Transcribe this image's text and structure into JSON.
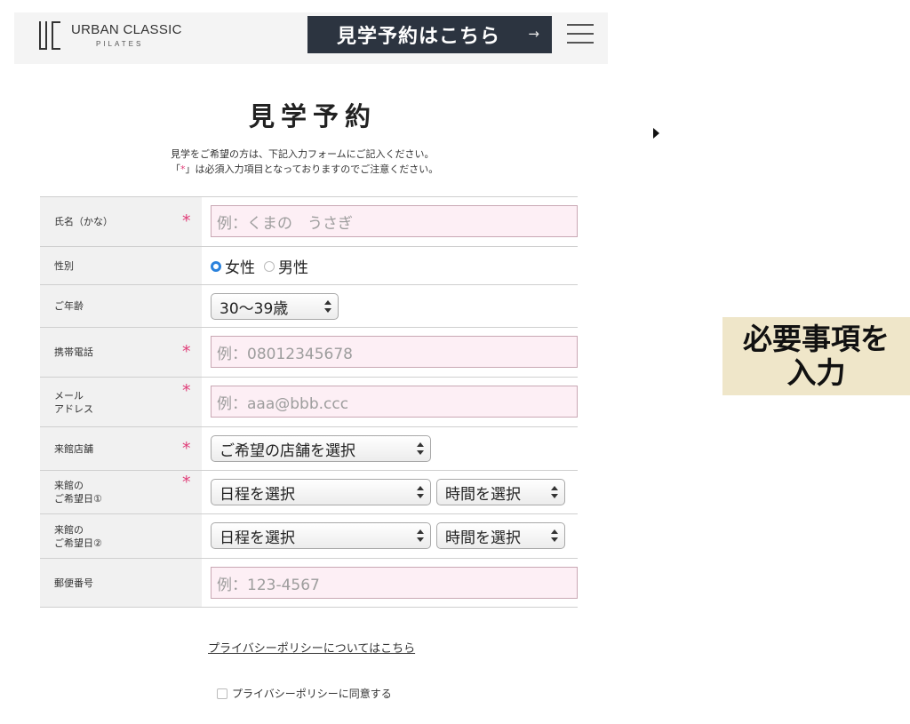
{
  "header": {
    "logo_name": "URBAN CLASSIC",
    "logo_sub": "PILATES",
    "cta_label": "見学予約はこちら",
    "cta_arrow": "→",
    "cta_color": "#2c3440"
  },
  "page": {
    "title": "見学予約",
    "intro_line1": "見学をご希望の方は、下記入力フォームにご記入ください。",
    "intro_line2_open": "「",
    "intro_line2_star": "*",
    "intro_line2_rest": "」は必須入力項目となっておりますのでご注意ください。",
    "required_color": "#e0407a"
  },
  "form": {
    "required_mark": "*",
    "name": {
      "label": "氏名（かな）",
      "placeholder": "例：くまの　うさぎ"
    },
    "gender": {
      "label": "性別",
      "options": [
        "女性",
        "男性"
      ],
      "selected": "女性"
    },
    "age": {
      "label": "ご年齢",
      "value": "30〜39歳"
    },
    "phone": {
      "label": "携帯電話",
      "placeholder": "例：08012345678"
    },
    "email": {
      "label_line1": "メール",
      "label_line2": "アドレス",
      "placeholder": "例：aaa@bbb.ccc"
    },
    "store": {
      "label": "来館店舗",
      "value": "ご希望の店舗を選択"
    },
    "visit1": {
      "label_line1": "来館の",
      "label_line2": "ご希望日①",
      "date": "日程を選択",
      "time": "時間を選択"
    },
    "visit2": {
      "label_line1": "来館の",
      "label_line2": "ご希望日②",
      "date": "日程を選択",
      "time": "時間を選択"
    },
    "postal": {
      "label": "郵便番号",
      "placeholder": "例：123-4567"
    },
    "field_bg": "#fdeff5"
  },
  "footer": {
    "policy_link": "プライバシーポリシーについてはこちら",
    "agree_label": "プライバシーポリシーに同意する"
  },
  "overlay": {
    "caption_line1": "必要事項を",
    "caption_line2": "入力",
    "caption_bg": "#efe6c9",
    "play_icon": "play-icon"
  }
}
